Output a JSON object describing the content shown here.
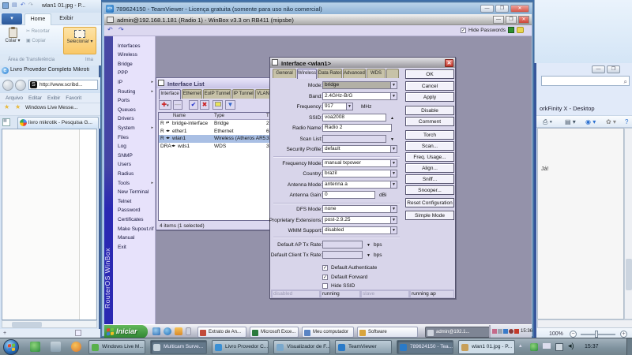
{
  "paint": {
    "title": "wlan1 01.jpg - P...",
    "tab_home": "Home",
    "tab_exibir": "Exibir",
    "colar": "Colar",
    "recortar": "Recortar",
    "copiar": "Copiar",
    "selecionar": "Selecionar",
    "group_clipboard": "Área de Transferência",
    "group_image": "Ima"
  },
  "browser": {
    "title": "Livro Provedor Completo Mikroti",
    "url": "http://www.scribd...",
    "menu": [
      "Arquivo",
      "Editar",
      "Exibir",
      "Favorit"
    ],
    "favorites_item": "Windows Live Messe...",
    "tab": "livro mikrotik - Pesquisa G..."
  },
  "teamviewer": {
    "title": "789624150 - TeamViewer - Licença gratuita (somente para uso não comercial)"
  },
  "winbox": {
    "title": "admin@192.168.1.181 (Radio 1) - WinBox v3.3 on RB411 (mipsbe)",
    "hide_passwords": "Hide Passwords",
    "brand": "RouterOS WinBox",
    "menu": [
      {
        "label": "Interfaces",
        "arrow": false
      },
      {
        "label": "Wireless",
        "arrow": false
      },
      {
        "label": "Bridge",
        "arrow": false
      },
      {
        "label": "PPP",
        "arrow": false
      },
      {
        "label": "IP",
        "arrow": true
      },
      {
        "label": "Routing",
        "arrow": true
      },
      {
        "label": "Ports",
        "arrow": false
      },
      {
        "label": "Queues",
        "arrow": false
      },
      {
        "label": "Drivers",
        "arrow": false
      },
      {
        "label": "System",
        "arrow": true
      },
      {
        "label": "Files",
        "arrow": false
      },
      {
        "label": "Log",
        "arrow": false
      },
      {
        "label": "SNMP",
        "arrow": false
      },
      {
        "label": "Users",
        "arrow": false
      },
      {
        "label": "Radius",
        "arrow": false
      },
      {
        "label": "Tools",
        "arrow": true
      },
      {
        "label": "New Terminal",
        "arrow": false
      },
      {
        "label": "Telnet",
        "arrow": false
      },
      {
        "label": "Password",
        "arrow": false
      },
      {
        "label": "Certificates",
        "arrow": false
      },
      {
        "label": "Make Supout.rif",
        "arrow": false
      },
      {
        "label": "Manual",
        "arrow": false
      },
      {
        "label": "Exit",
        "arrow": false
      }
    ]
  },
  "interface_list": {
    "title": "Interface List",
    "tabs": [
      "Interface",
      "Ethernet",
      "EoIP Tunnel",
      "IP Tunnel",
      "VLAN"
    ],
    "col_name": "Name",
    "col_type": "Type",
    "col_tx": "T",
    "rows": [
      {
        "flags": "R",
        "icon": "⇄",
        "name": "bridge-interface",
        "type": "Bridge",
        "tx": "2",
        "selected": false
      },
      {
        "flags": "R",
        "icon": "◂▸",
        "name": "ether1",
        "type": "Ethernet",
        "tx": "6",
        "selected": false
      },
      {
        "flags": "R",
        "icon": "◂▸",
        "name": "wlan1",
        "type": "Wireless (Atheros AR5...",
        "tx": "3",
        "selected": true
      },
      {
        "flags": "DRA",
        "icon": "◂▸",
        "name": "wds1",
        "type": "WDS",
        "tx": "3",
        "selected": false
      }
    ],
    "status": "4 items (1 selected)"
  },
  "wlan_dialog": {
    "title": "Interface <wlan1>",
    "tabs": [
      "General",
      "Wireless",
      "Data Rates",
      "Advanced",
      "WDS"
    ],
    "active_tab": "Wireless",
    "fields": [
      {
        "label": "Mode:",
        "value": "bridge",
        "kind": "drop-sel",
        "suffix": ""
      },
      {
        "label": "Band:",
        "value": "2.4GHz-B/G",
        "kind": "drop",
        "suffix": ""
      },
      {
        "label": "Frequency:",
        "value": "917",
        "kind": "drop-narrow",
        "suffix": "MHz"
      },
      {
        "label": "SSID:",
        "value": "voa2008",
        "kind": "input-up",
        "suffix": ""
      },
      {
        "label": "Radio Name:",
        "value": "Radio 2",
        "kind": "input-wide",
        "suffix": ""
      },
      {
        "label": "Scan List:",
        "value": "",
        "kind": "disabled-down",
        "suffix": ""
      },
      {
        "label": "Security Profile:",
        "value": "default",
        "kind": "drop",
        "suffix": ""
      },
      {
        "label": "Frequency Mode:",
        "value": "manual txpower",
        "kind": "drop",
        "suffix": ""
      },
      {
        "label": "Country:",
        "value": "brazil",
        "kind": "drop",
        "suffix": ""
      },
      {
        "label": "Antenna Mode:",
        "value": "antenna a",
        "kind": "drop",
        "suffix": ""
      },
      {
        "label": "Antenna Gain:",
        "value": "0",
        "kind": "input-med",
        "suffix": "dBi"
      },
      {
        "label": "DFS Mode:",
        "value": "none",
        "kind": "drop",
        "suffix": ""
      },
      {
        "label": "Proprietary Extensions:",
        "value": "post-2.9.25",
        "kind": "drop",
        "suffix": ""
      },
      {
        "label": "WMM Support:",
        "value": "disabled",
        "kind": "drop",
        "suffix": ""
      },
      {
        "label": "Default AP Tx Rate:",
        "value": "",
        "kind": "rate",
        "suffix": "bps"
      },
      {
        "label": "Default Client Tx Rate:",
        "value": "",
        "kind": "rate",
        "suffix": "bps"
      }
    ],
    "checkboxes": [
      {
        "label": "Default Authenticate",
        "checked": true
      },
      {
        "label": "Default Forward",
        "checked": true
      },
      {
        "label": "Hide SSID",
        "checked": false
      }
    ],
    "status_cells": [
      {
        "text": "disabled",
        "dim": true
      },
      {
        "text": "running",
        "dim": false
      },
      {
        "text": "slave",
        "dim": true
      },
      {
        "text": "running ap",
        "dim": false
      }
    ],
    "buttons": [
      "OK",
      "Cancel",
      "Apply",
      "Disable",
      "Comment",
      "Torch",
      "Scan...",
      "Freq. Usage...",
      "Align...",
      "Sniff...",
      "Snooper...",
      "Reset Configuration",
      "Simple Mode"
    ]
  },
  "xp_taskbar": {
    "start": "Iniciar",
    "buttons": [
      {
        "label": "Extrato de An...",
        "pressed": false,
        "ico": "#c24a3a"
      },
      {
        "label": "Microsoft Exce...",
        "pressed": false,
        "ico": "#2a7a3c"
      },
      {
        "label": "Meu computador",
        "pressed": false,
        "ico": "#5a84c4"
      },
      {
        "label": "Software",
        "pressed": false,
        "ico": "#d9a43c"
      },
      {
        "label": "admin@192.1...",
        "pressed": true,
        "ico": "#cfd4de"
      }
    ],
    "clock": "15:36"
  },
  "desktop_taskbar": {
    "buttons": [
      {
        "label": "Windows Live M...",
        "state": "",
        "ico": "#58b04a"
      },
      {
        "label": "Multicam Surve...",
        "state": "pressed",
        "ico": "#c8d4dc"
      },
      {
        "label": "Livro Provedor C...",
        "state": "",
        "ico": "#3a8fd4"
      },
      {
        "label": "Visualizador de F...",
        "state": "",
        "ico": "#7aa8cc"
      },
      {
        "label": "TeamViewer",
        "state": "",
        "ico": "#2a7ac8"
      },
      {
        "label": "789624150 - Tea...",
        "state": "pressed",
        "ico": "#2a7ac8"
      },
      {
        "label": "wlan1 01.jpg - P...",
        "state": "lite",
        "ico": "#c8a05a"
      }
    ],
    "clock": "15:37"
  },
  "right_window": {
    "title": "orkFinity X - Desktop",
    "content_text": "Já!",
    "zoom_level": "100%"
  }
}
